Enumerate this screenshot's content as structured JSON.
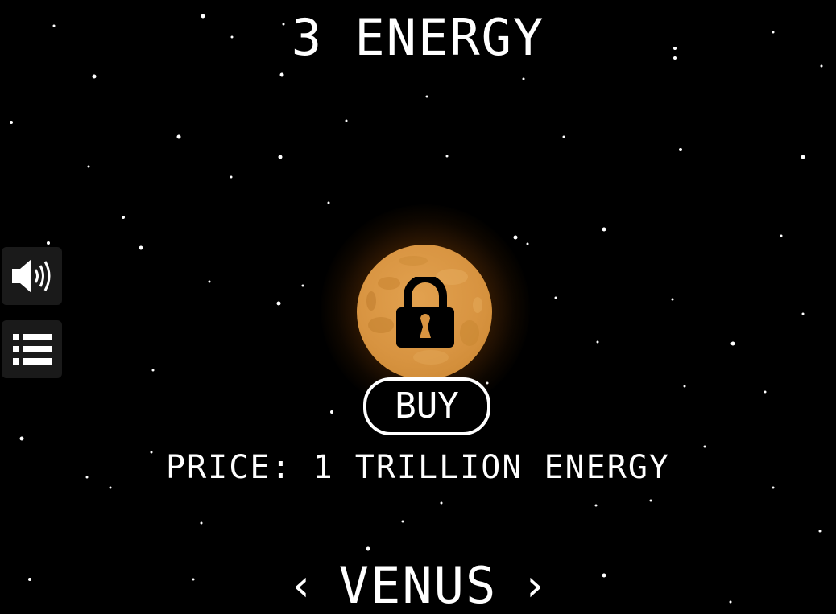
{
  "hud": {
    "energy_counter": "3 ENERGY"
  },
  "side_buttons": [
    {
      "icon": "speaker-icon"
    },
    {
      "icon": "list-icon"
    }
  ],
  "planet": {
    "color": "#d89441",
    "glow_color": "#d4781a",
    "locked": true
  },
  "shop": {
    "buy_label": "BUY",
    "price_text": "PRICE: 1 TRILLION ENERGY"
  },
  "navigation": {
    "prev_arrow": "‹",
    "next_arrow": "›",
    "planet_name": "VENUS"
  }
}
